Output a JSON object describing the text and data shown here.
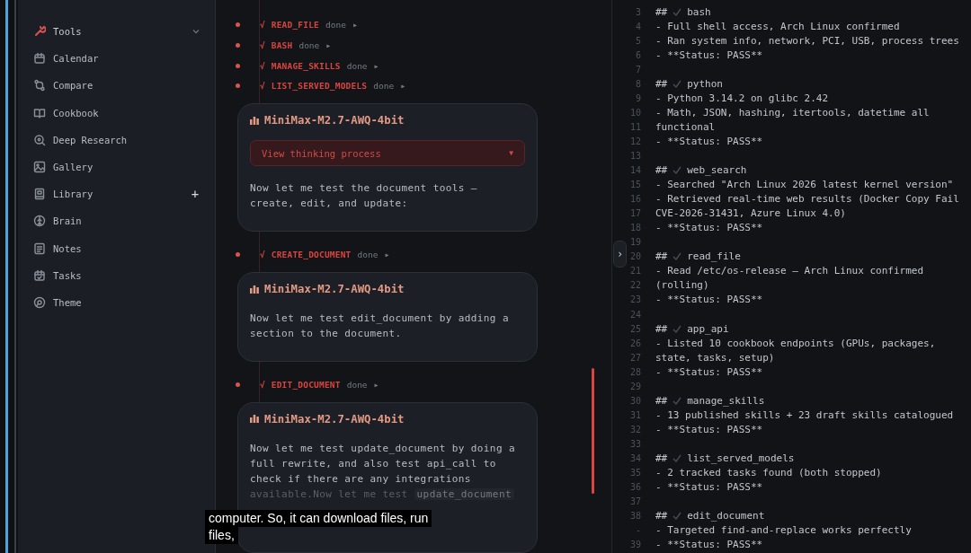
{
  "sidebar": {
    "items": [
      {
        "label": "Tools",
        "expanded": true,
        "active": true
      },
      {
        "label": "Calendar",
        "active": false
      },
      {
        "label": "Compare",
        "active": false
      },
      {
        "label": "Cookbook",
        "active": false
      },
      {
        "label": "Deep Research",
        "active": false
      },
      {
        "label": "Gallery",
        "active": false
      },
      {
        "label": "Library",
        "action": "+",
        "active": false
      },
      {
        "label": "Brain",
        "active": false
      },
      {
        "label": "Notes",
        "active": false
      },
      {
        "label": "Tasks",
        "active": false
      },
      {
        "label": "Theme",
        "active": false
      }
    ]
  },
  "chat": {
    "timeline": [
      {
        "kind": "step",
        "check": "√",
        "name": "READ_FILE",
        "status": "done",
        "arrow": "▸"
      },
      {
        "kind": "step",
        "check": "√",
        "name": "BASH",
        "status": "done",
        "arrow": "▸"
      },
      {
        "kind": "step",
        "check": "√",
        "name": "MANAGE_SKILLS",
        "status": "done",
        "arrow": "▸"
      },
      {
        "kind": "step",
        "check": "√",
        "name": "LIST_SERVED_MODELS",
        "status": "done",
        "arrow": "▸"
      },
      {
        "kind": "message",
        "model": "MiniMax-M2.7-AWQ-4bit",
        "thinking": {
          "label": "View thinking process",
          "caret": "▼",
          "expanded": false
        },
        "text": "Now let me test the document tools — create, edit, and update:"
      },
      {
        "kind": "step",
        "check": "√",
        "name": "CREATE_DOCUMENT",
        "status": "done",
        "arrow": "▸"
      },
      {
        "kind": "message",
        "model": "MiniMax-M2.7-AWQ-4bit",
        "text": "Now let me test edit_document by adding a section to the document."
      },
      {
        "kind": "step",
        "check": "√",
        "name": "EDIT_DOCUMENT",
        "status": "done",
        "arrow": "▸"
      },
      {
        "kind": "message",
        "model": "MiniMax-M2.7-AWQ-4bit",
        "text": "Now let me test update_document by doing a full rewrite, and also test api_call to check if there are any integrations",
        "tail": [
          [
            {
              "kind": "plain",
              "text": "available.Now let me test "
            },
            {
              "kind": "code",
              "text": "update_document"
            }
          ]
        ]
      }
    ]
  },
  "panel_toggle": "›",
  "document": {
    "rows": [
      {
        "n": "3",
        "kind": "heading",
        "prefix": "##",
        "text": "bash"
      },
      {
        "n": "4",
        "kind": "line",
        "text": "- Full shell access, Arch Linux confirmed"
      },
      {
        "n": "5",
        "kind": "line",
        "text": "- Ran system info, network, PCI, USB, process trees"
      },
      {
        "n": "6",
        "kind": "line",
        "text": "- **Status: PASS**"
      },
      {
        "n": "7",
        "kind": "blank"
      },
      {
        "n": "8",
        "kind": "heading",
        "prefix": "##",
        "text": "python"
      },
      {
        "n": "9",
        "kind": "line",
        "text": "- Python 3.14.2 on glibc 2.42"
      },
      {
        "n": "10",
        "kind": "line",
        "text": "- Math, JSON, hashing, itertools, datetime all"
      },
      {
        "n": "11",
        "kind": "line",
        "text": "functional"
      },
      {
        "n": "12",
        "kind": "line",
        "text": "- **Status: PASS**"
      },
      {
        "n": "13",
        "kind": "blank"
      },
      {
        "n": "14",
        "kind": "heading",
        "prefix": "##",
        "text": "web_search"
      },
      {
        "n": "15",
        "kind": "line",
        "text": "- Searched \"Arch Linux 2026 latest kernel version\""
      },
      {
        "n": "16",
        "kind": "line",
        "text": "- Retrieved real-time web results (Docker Copy Fail"
      },
      {
        "n": "17",
        "kind": "line",
        "text": "CVE-2026-31431, Azure Linux 4.0)"
      },
      {
        "n": "18",
        "kind": "line",
        "text": "- **Status: PASS**"
      },
      {
        "n": "19",
        "kind": "blank"
      },
      {
        "n": "20",
        "kind": "heading",
        "prefix": "##",
        "text": "read_file"
      },
      {
        "n": "21",
        "kind": "line",
        "text": "- Read /etc/os-release — Arch Linux confirmed"
      },
      {
        "n": "22",
        "kind": "line",
        "text": "(rolling)"
      },
      {
        "n": "23",
        "kind": "line",
        "text": "- **Status: PASS**"
      },
      {
        "n": "24",
        "kind": "blank"
      },
      {
        "n": "25",
        "kind": "heading",
        "prefix": "##",
        "text": "app_api"
      },
      {
        "n": "26",
        "kind": "line",
        "text": "- Listed 10 cookbook endpoints (GPUs, packages,"
      },
      {
        "n": "27",
        "kind": "line",
        "text": "state, tasks, setup)"
      },
      {
        "n": "28",
        "kind": "line",
        "text": "- **Status: PASS**"
      },
      {
        "n": "29",
        "kind": "blank"
      },
      {
        "n": "30",
        "kind": "heading",
        "prefix": "##",
        "text": "manage_skills"
      },
      {
        "n": "31",
        "kind": "line",
        "text": "- 13 published skills + 23 draft skills catalogued"
      },
      {
        "n": "32",
        "kind": "line",
        "text": "- **Status: PASS**"
      },
      {
        "n": "33",
        "kind": "blank"
      },
      {
        "n": "34",
        "kind": "heading",
        "prefix": "##",
        "text": "list_served_models"
      },
      {
        "n": "35",
        "kind": "line",
        "text": "- 2 tracked tasks found (both stopped)"
      },
      {
        "n": "36",
        "kind": "line",
        "text": "- **Status: PASS**"
      },
      {
        "n": "37",
        "kind": "blank"
      },
      {
        "n": "38",
        "kind": "heading",
        "prefix": "##",
        "text": "edit_document"
      },
      {
        "n": "-",
        "kind": "line",
        "text": "- Targeted find-and-replace works perfectly"
      },
      {
        "n": "39",
        "kind": "line",
        "text": "- **Status: PASS**"
      }
    ]
  },
  "caption": {
    "lines": [
      "computer. So, it can download files, run",
      "files,"
    ]
  }
}
